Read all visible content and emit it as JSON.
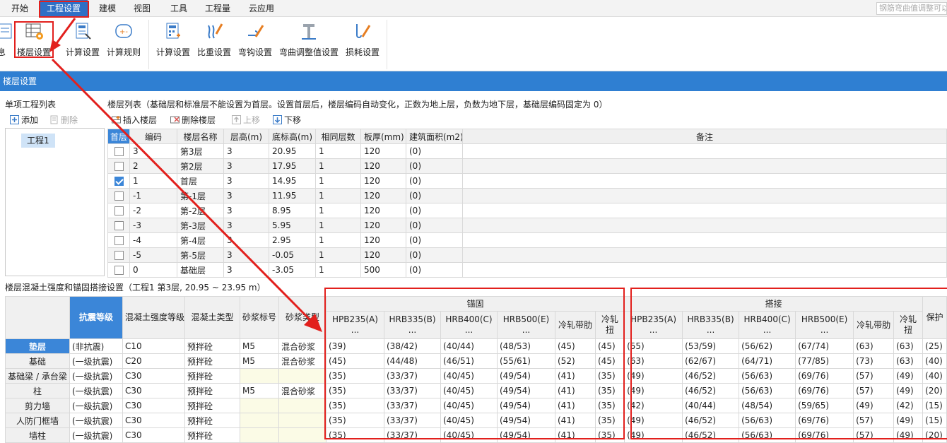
{
  "menu": {
    "items": [
      "开始",
      "工程设置",
      "建模",
      "视图",
      "工具",
      "工程量",
      "云应用"
    ],
    "active_index": 1,
    "search_placeholder": "钢筋弯曲值调整可以"
  },
  "ribbon": {
    "buttons": [
      "息",
      "楼层设置",
      "计算设置",
      "计算规则",
      "计算设置",
      "比重设置",
      "弯钩设置",
      "弯曲调整值设置",
      "损耗设置"
    ]
  },
  "panel_title": "楼层设置",
  "left": {
    "title": "单项工程列表",
    "add": "添加",
    "delete": "删除",
    "projects": [
      "工程1"
    ]
  },
  "floor_list": {
    "title": "楼层列表（基础层和标准层不能设置为首层。设置首层后，楼层编码自动变化，正数为地上层，负数为地下层，基础层编码固定为 0）",
    "toolbar": [
      "插入楼层",
      "删除楼层",
      "上移",
      "下移"
    ],
    "headers": [
      "首层",
      "编码",
      "楼层名称",
      "层高(m)",
      "底标高(m)",
      "相同层数",
      "板厚(mm)",
      "建筑面积(m2)",
      "备注"
    ],
    "rows": [
      {
        "first": false,
        "code": "3",
        "name": "第3层",
        "height": "3",
        "bottom": "20.95",
        "same": "1",
        "thick": "120",
        "area": "(0)",
        "note": ""
      },
      {
        "first": false,
        "code": "2",
        "name": "第2层",
        "height": "3",
        "bottom": "17.95",
        "same": "1",
        "thick": "120",
        "area": "(0)",
        "note": ""
      },
      {
        "first": true,
        "code": "1",
        "name": "首层",
        "height": "3",
        "bottom": "14.95",
        "same": "1",
        "thick": "120",
        "area": "(0)",
        "note": ""
      },
      {
        "first": false,
        "code": "-1",
        "name": "第-1层",
        "height": "3",
        "bottom": "11.95",
        "same": "1",
        "thick": "120",
        "area": "(0)",
        "note": ""
      },
      {
        "first": false,
        "code": "-2",
        "name": "第-2层",
        "height": "3",
        "bottom": "8.95",
        "same": "1",
        "thick": "120",
        "area": "(0)",
        "note": ""
      },
      {
        "first": false,
        "code": "-3",
        "name": "第-3层",
        "height": "3",
        "bottom": "5.95",
        "same": "1",
        "thick": "120",
        "area": "(0)",
        "note": ""
      },
      {
        "first": false,
        "code": "-4",
        "name": "第-4层",
        "height": "3",
        "bottom": "2.95",
        "same": "1",
        "thick": "120",
        "area": "(0)",
        "note": ""
      },
      {
        "first": false,
        "code": "-5",
        "name": "第-5层",
        "height": "3",
        "bottom": "-0.05",
        "same": "1",
        "thick": "120",
        "area": "(0)",
        "note": ""
      },
      {
        "first": false,
        "code": "0",
        "name": "基础层",
        "height": "3",
        "bottom": "-3.05",
        "same": "1",
        "thick": "500",
        "area": "(0)",
        "note": ""
      }
    ]
  },
  "concrete": {
    "title": "楼层混凝土强度和锚固搭接设置（工程1 第3层, 20.95 ~ 23.95 m）",
    "group_anchor": "锚固",
    "group_lap": "搭接",
    "headers": [
      "抗震等级",
      "混凝土强度等级",
      "混凝土类型",
      "砂浆标号",
      "砂浆类型"
    ],
    "anchor_headers": [
      "HPB235(A)\n...",
      "HRB335(B)\n...",
      "HRB400(C)\n...",
      "HRB500(E)\n...",
      "冷轧带肋",
      "冷轧扭"
    ],
    "lap_headers": [
      "HPB235(A)\n...",
      "HRB335(B)\n...",
      "HRB400(C)\n...",
      "HRB500(E)\n...",
      "冷轧带肋",
      "冷轧扭"
    ],
    "extra_header": "保护",
    "rows": [
      {
        "name": "垫层",
        "grade": "(非抗震)",
        "strength": "C10",
        "type": "预拌砼",
        "mortar_no": "M5",
        "mortar_type": "混合砂浆",
        "anchor": [
          "(39)",
          "(38/42)",
          "(40/44)",
          "(48/53)",
          "(45)",
          "(45)"
        ],
        "lap": [
          "(55)",
          "(53/59)",
          "(56/62)",
          "(67/74)",
          "(63)",
          "(63)"
        ],
        "extra": "(25)"
      },
      {
        "name": "基础",
        "grade": "(一级抗震)",
        "strength": "C20",
        "type": "预拌砼",
        "mortar_no": "M5",
        "mortar_type": "混合砂浆",
        "anchor": [
          "(45)",
          "(44/48)",
          "(46/51)",
          "(55/61)",
          "(52)",
          "(45)"
        ],
        "lap": [
          "(63)",
          "(62/67)",
          "(64/71)",
          "(77/85)",
          "(73)",
          "(63)"
        ],
        "extra": "(40)"
      },
      {
        "name": "基础梁 / 承台梁",
        "grade": "(一级抗震)",
        "strength": "C30",
        "type": "预拌砼",
        "mortar_no": "",
        "mortar_type": "",
        "anchor": [
          "(35)",
          "(33/37)",
          "(40/45)",
          "(49/54)",
          "(41)",
          "(35)"
        ],
        "lap": [
          "(49)",
          "(46/52)",
          "(56/63)",
          "(69/76)",
          "(57)",
          "(49)"
        ],
        "extra": "(40)"
      },
      {
        "name": "柱",
        "grade": "(一级抗震)",
        "strength": "C30",
        "type": "预拌砼",
        "mortar_no": "M5",
        "mortar_type": "混合砂浆",
        "anchor": [
          "(35)",
          "(33/37)",
          "(40/45)",
          "(49/54)",
          "(41)",
          "(35)"
        ],
        "lap": [
          "(49)",
          "(46/52)",
          "(56/63)",
          "(69/76)",
          "(57)",
          "(49)"
        ],
        "extra": "(20)"
      },
      {
        "name": "剪力墙",
        "grade": "(一级抗震)",
        "strength": "C30",
        "type": "预拌砼",
        "mortar_no": "",
        "mortar_type": "",
        "anchor": [
          "(35)",
          "(33/37)",
          "(40/45)",
          "(49/54)",
          "(41)",
          "(35)"
        ],
        "lap": [
          "(42)",
          "(40/44)",
          "(48/54)",
          "(59/65)",
          "(49)",
          "(42)"
        ],
        "extra": "(15)"
      },
      {
        "name": "人防门框墙",
        "grade": "(一级抗震)",
        "strength": "C30",
        "type": "预拌砼",
        "mortar_no": "",
        "mortar_type": "",
        "anchor": [
          "(35)",
          "(33/37)",
          "(40/45)",
          "(49/54)",
          "(41)",
          "(35)"
        ],
        "lap": [
          "(49)",
          "(46/52)",
          "(56/63)",
          "(69/76)",
          "(57)",
          "(49)"
        ],
        "extra": "(15)"
      },
      {
        "name": "墙柱",
        "grade": "(一级抗震)",
        "strength": "C30",
        "type": "预拌砼",
        "mortar_no": "",
        "mortar_type": "",
        "anchor": [
          "(35)",
          "(33/37)",
          "(40/45)",
          "(49/54)",
          "(41)",
          "(35)"
        ],
        "lap": [
          "(49)",
          "(46/52)",
          "(56/63)",
          "(69/76)",
          "(57)",
          "(49)"
        ],
        "extra": "(20)"
      }
    ]
  },
  "colors": {
    "accent": "#2f7fd2",
    "selected": "#3b86d8",
    "annotation": "#e2201d",
    "highlight_cell": "#fbfbe6"
  }
}
